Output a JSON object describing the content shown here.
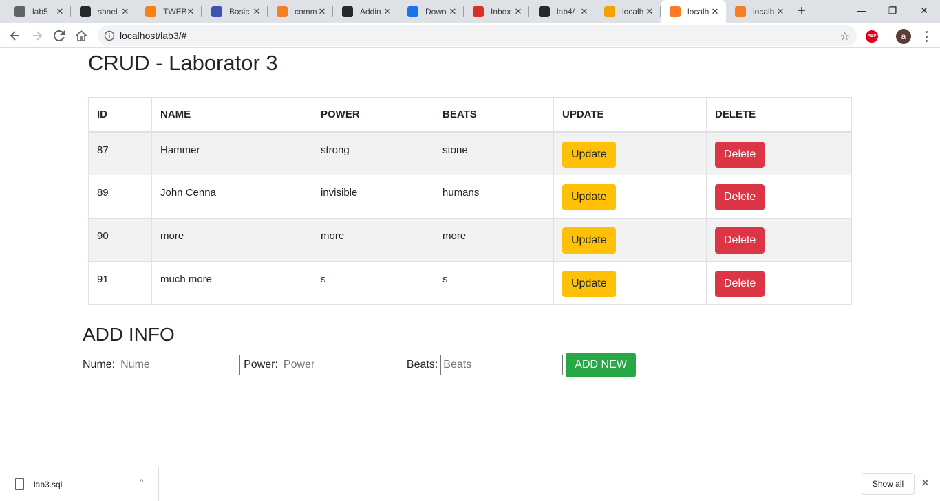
{
  "browser": {
    "tabs": [
      {
        "title": "lab5",
        "icon": "globe-icon",
        "color": "#5f6368"
      },
      {
        "title": "shnel",
        "icon": "github-icon",
        "color": "#24292e"
      },
      {
        "title": "TWEB",
        "icon": "moodle-icon",
        "color": "#f98012"
      },
      {
        "title": "Basic",
        "icon": "circle-icon",
        "color": "#3f51b5"
      },
      {
        "title": "comm",
        "icon": "stackoverflow-icon",
        "color": "#f48024"
      },
      {
        "title": "Addin",
        "icon": "github-icon",
        "color": "#24292e"
      },
      {
        "title": "Down",
        "icon": "download-icon",
        "color": "#1a73e8"
      },
      {
        "title": "Inbox",
        "icon": "gmail-icon",
        "color": "#d93025"
      },
      {
        "title": "lab4/",
        "icon": "github-icon",
        "color": "#24292e"
      },
      {
        "title": "localh",
        "icon": "phpmyadmin-icon",
        "color": "#f5a100"
      },
      {
        "title": "localh",
        "icon": "xampp-icon",
        "color": "#fb7a24",
        "active": true
      },
      {
        "title": "localh",
        "icon": "xampp-icon",
        "color": "#fb7a24"
      }
    ],
    "url": "localhost/lab3/#",
    "extension_label": "ABP",
    "profile_initial": "a"
  },
  "page": {
    "title": "CRUD - Laborator 3",
    "table": {
      "headers": [
        "ID",
        "NAME",
        "POWER",
        "BEATS",
        "UPDATE",
        "DELETE"
      ],
      "rows": [
        {
          "id": "87",
          "name": "Hammer",
          "power": "strong",
          "beats": "stone"
        },
        {
          "id": "89",
          "name": "John Cenna",
          "power": "invisible",
          "beats": "humans"
        },
        {
          "id": "90",
          "name": "more",
          "power": "more",
          "beats": "more"
        },
        {
          "id": "91",
          "name": "much more",
          "power": "s",
          "beats": "s"
        }
      ],
      "update_label": "Update",
      "delete_label": "Delete"
    },
    "add_section": {
      "title": "ADD INFO",
      "nume_label": "Nume:",
      "nume_placeholder": "Nume",
      "power_label": "Power:",
      "power_placeholder": "Power",
      "beats_label": "Beats:",
      "beats_placeholder": "Beats",
      "add_button": "ADD NEW"
    }
  },
  "downloads": {
    "file_name": "lab3.sql",
    "show_all": "Show all"
  },
  "colors": {
    "update": "#ffc107",
    "delete": "#dc3545",
    "add": "#28a745"
  }
}
